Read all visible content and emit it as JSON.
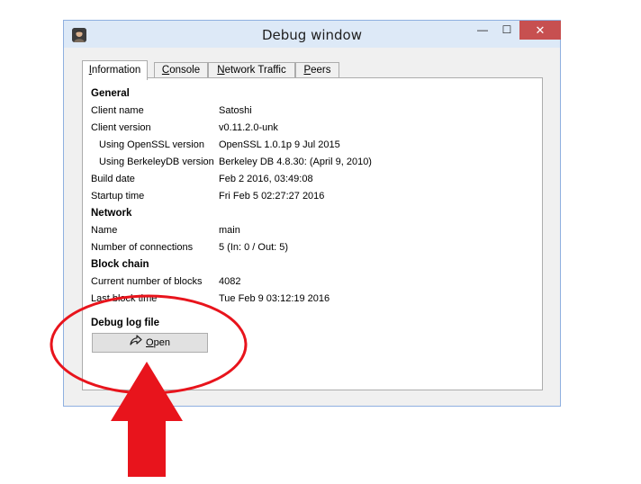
{
  "window": {
    "title": "Debug window",
    "controls": {
      "minimize": "—",
      "maximize": "☐",
      "close": "✕"
    }
  },
  "tabs": [
    {
      "label": "Information",
      "mnemonic": "I",
      "rest": "nformation",
      "active": true
    },
    {
      "label": "Console",
      "mnemonic": "C",
      "rest": "onsole"
    },
    {
      "label": "Network Traffic",
      "mnemonic": "N",
      "rest": "etwork Traffic"
    },
    {
      "label": "Peers",
      "mnemonic": "P",
      "rest": "eers"
    }
  ],
  "info": {
    "general": {
      "heading": "General",
      "client_name_label": "Client name",
      "client_name": "Satoshi",
      "client_version_label": "Client version",
      "client_version": "v0.11.2.0-unk",
      "openssl_label": "Using OpenSSL version",
      "openssl": "OpenSSL 1.0.1p 9 Jul 2015",
      "berkeley_label": "Using BerkeleyDB version",
      "berkeley": "Berkeley DB 4.8.30: (April  9, 2010)",
      "build_date_label": "Build date",
      "build_date": "Feb  2 2016, 03:49:08",
      "startup_label": "Startup time",
      "startup": "Fri Feb 5 02:27:27 2016"
    },
    "network": {
      "heading": "Network",
      "name_label": "Name",
      "name": "main",
      "connections_label": "Number of connections",
      "connections": "5 (In: 0 / Out: 5)"
    },
    "blockchain": {
      "heading": "Block chain",
      "blocks_label": "Current number of blocks",
      "blocks": "4082",
      "last_block_label": "Last block time",
      "last_block": "Tue Feb 9 03:12:19 2016"
    },
    "debug_log": {
      "heading": "Debug log file",
      "open_button": "Open",
      "open_mnemonic": "O",
      "open_rest": "pen"
    }
  },
  "annotation": {
    "color": "#e8141c"
  }
}
